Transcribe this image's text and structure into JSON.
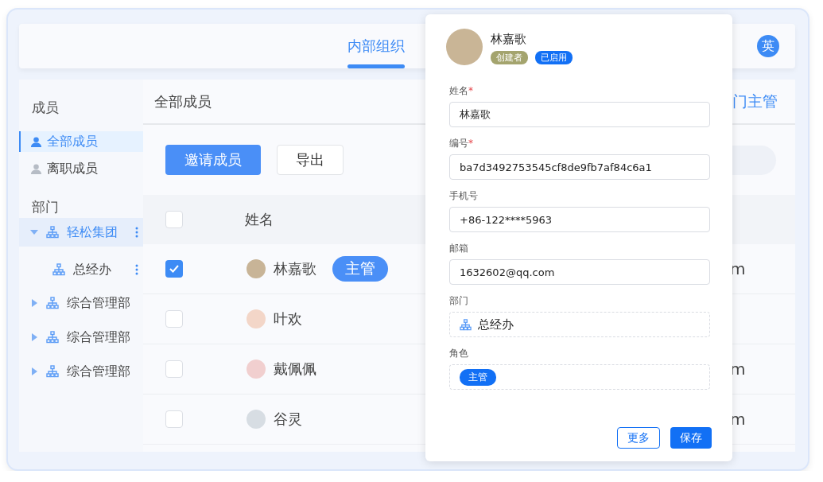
{
  "header": {
    "tabs": [
      {
        "label": "内部组织",
        "selected": true
      }
    ],
    "user_initial": "英"
  },
  "sidebar": {
    "members_heading": "成员",
    "member_items": [
      {
        "label": "全部成员",
        "selected": true
      },
      {
        "label": "离职成员",
        "selected": false
      }
    ],
    "departments_heading": "部门",
    "departments": [
      {
        "label": "轻松集团",
        "selected": true,
        "expanded": true,
        "children": [
          {
            "label": "总经办",
            "selected": false,
            "expanded": false
          }
        ]
      },
      {
        "label": "综合管理部",
        "selected": false,
        "expanded": false
      },
      {
        "label": "综合管理部",
        "selected": false,
        "expanded": false
      },
      {
        "label": "综合管理部",
        "selected": false,
        "expanded": false
      }
    ]
  },
  "main": {
    "title": "全部成员",
    "right_tab": "门主管",
    "buttons": [
      {
        "label": "邀请成员",
        "kind": "primary"
      },
      {
        "label": "导出",
        "kind": "outline"
      }
    ],
    "table": {
      "columns": [
        "姓名"
      ],
      "header_checked": false,
      "rows": [
        {
          "checked": true,
          "name": "林嘉歌",
          "badge": "主管",
          "column_3": "m"
        },
        {
          "checked": false,
          "name": "叶欢"
        },
        {
          "checked": false,
          "name": "戴佩佩",
          "column_3": "m"
        },
        {
          "checked": false,
          "name": "谷灵",
          "column_3": "m"
        }
      ]
    }
  },
  "detail_panel": {
    "name": "林嘉歌",
    "tags": [
      {
        "label": "创建者",
        "color": "#a4a46e"
      },
      {
        "label": "已启用",
        "color": "#1270f5"
      }
    ],
    "fields": [
      {
        "label": "姓名",
        "required_mark": "*",
        "kind": "input",
        "value": "林嘉歌"
      },
      {
        "label": "编号",
        "required_mark": "*",
        "kind": "input",
        "value": "ba7d3492753545cf8de9fb7af84c6a1"
      },
      {
        "label": "手机号",
        "kind": "input",
        "value": "+86-122****5963"
      },
      {
        "label": "邮箱",
        "kind": "input",
        "value": "1632602@qq.com"
      },
      {
        "label": "部门",
        "kind": "department",
        "value": "总经办"
      },
      {
        "label": "角色",
        "kind": "chips",
        "value": "主管"
      }
    ],
    "buttons": [
      {
        "label": "更多",
        "kind": "outline"
      },
      {
        "label": "保存",
        "kind": "primary"
      }
    ]
  }
}
